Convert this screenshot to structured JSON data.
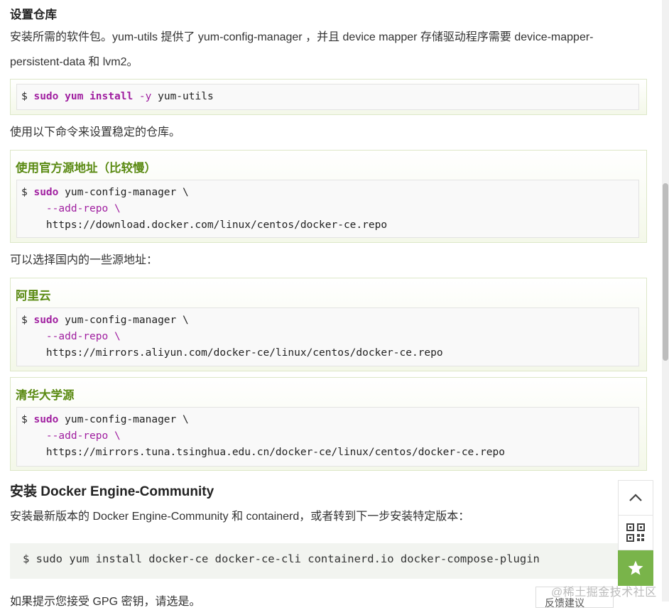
{
  "section_setup": {
    "title": "设置仓库",
    "intro_line1": "安装所需的软件包。yum-utils 提供了 yum-config-manager ，并且 device mapper 存储驱动程序需要 device-mapper-",
    "intro_line2": "persistent-data 和 lvm2。",
    "cmd1": {
      "prompt": "$",
      "sudo": "sudo",
      "kw2": "yum",
      "kw3": "install",
      "opt": "-y",
      "rest": "yum-utils"
    },
    "stable_text": "使用以下命令来设置稳定的仓库。",
    "official": {
      "label": "使用官方源地址（比较慢）",
      "prompt": "$",
      "sudo": "sudo",
      "cmd": "yum-config-manager \\",
      "line2": "--add-repo \\",
      "line3": "https://download.docker.com/linux/centos/docker-ce.repo"
    },
    "domestic_text": "可以选择国内的一些源地址：",
    "aliyun": {
      "label": "阿里云",
      "prompt": "$",
      "sudo": "sudo",
      "cmd": "yum-config-manager \\",
      "line2": "--add-repo \\",
      "line3": "https://mirrors.aliyun.com/docker-ce/linux/centos/docker-ce.repo"
    },
    "tsinghua": {
      "label": "清华大学源",
      "prompt": "$",
      "sudo": "sudo",
      "cmd": "yum-config-manager \\",
      "line2": "--add-repo \\",
      "line3": "https://mirrors.tuna.tsinghua.edu.cn/docker-ce/linux/centos/docker-ce.repo"
    }
  },
  "section_install": {
    "title": "安装 Docker Engine-Community",
    "text": "安装最新版本的 Docker Engine-Community 和 containerd，或者转到下一步安装特定版本：",
    "cmd": "$ sudo yum install docker-ce docker-ce-cli containerd.io docker-compose-plugin",
    "cut_text": "如果提示您接受 GPG 密钥，请选是。"
  },
  "floating": {
    "feedback_label": "反馈建议",
    "watermark": "@稀土掘金技术社区"
  },
  "icons": {
    "top": "chevron-up-icon",
    "qr": "qr-code-icon",
    "star": "star-icon"
  },
  "colors": {
    "accent_green": "#5a8a12",
    "keyword_purple": "#a01fa0",
    "button_green": "#79b44a"
  }
}
